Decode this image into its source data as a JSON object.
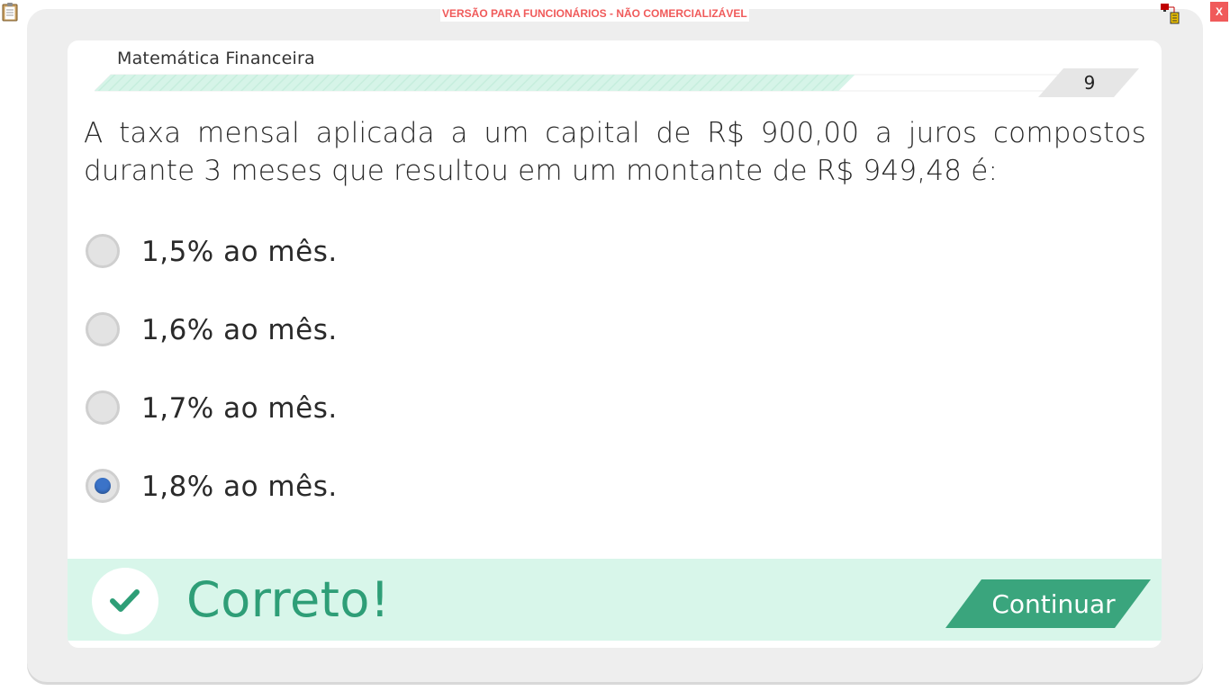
{
  "window": {
    "banner": "VERSÃO PARA FUNCIONÁRIOS - NÃO COMERCIALIZÁVEL",
    "close_label": "X",
    "icons": [
      "clipboard-icon",
      "network-monitor-icon"
    ]
  },
  "header": {
    "subject": "Matemática Financeira",
    "page_number": "9",
    "progress": 0.73
  },
  "question": {
    "text": "A taxa mensal aplicada a um capital de R$ 900,00 a juros compostos durante 3 meses que resultou em um montante de R$ 949,48 é:"
  },
  "options": [
    {
      "label": "1,5% ao mês.",
      "selected": false
    },
    {
      "label": "1,6% ao mês.",
      "selected": false
    },
    {
      "label": "1,7% ao mês.",
      "selected": false
    },
    {
      "label": "1,8% ao mês.",
      "selected": true
    }
  ],
  "feedback": {
    "status_text": "Correto!",
    "continue_label": "Continuar",
    "icon": "checkmark-icon"
  },
  "colors": {
    "accent_green": "#2e9e77",
    "feedback_bg": "#d8f6ea",
    "radio_selected": "#3b73c8",
    "banner_red": "#f05a5a"
  }
}
